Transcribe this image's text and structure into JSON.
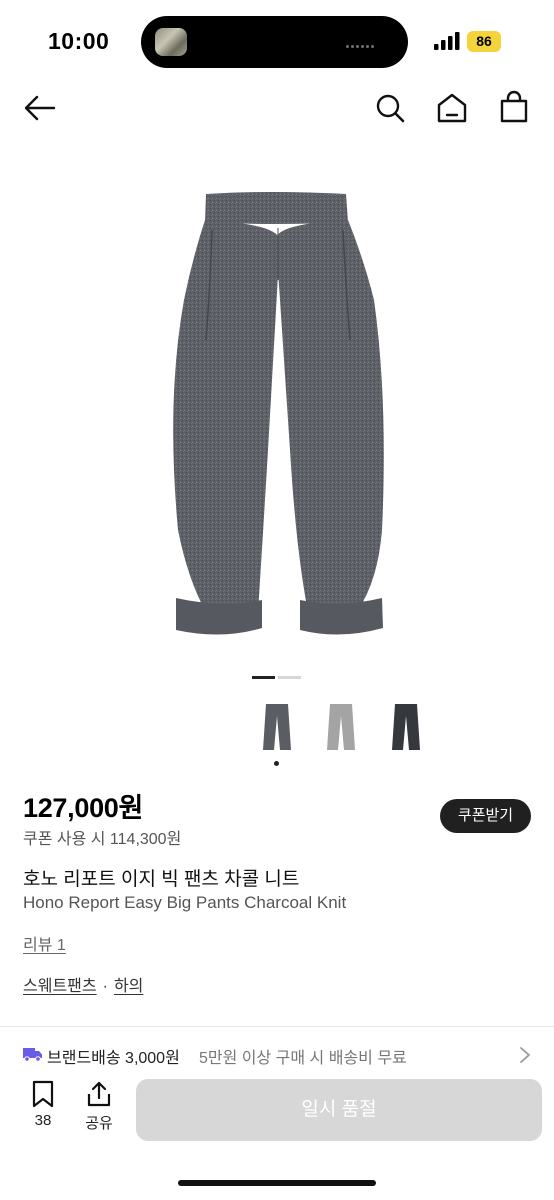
{
  "status_bar": {
    "time": "10:00",
    "battery": "86",
    "battery_color": "#f5d43b"
  },
  "header": {
    "icons": [
      "arrow-left-icon",
      "search-icon",
      "home-icon",
      "shopping-bag-icon"
    ]
  },
  "product": {
    "image_icon": "charcoal-pants-image",
    "image_count": 2,
    "current_image": 1,
    "color_options": [
      {
        "name": "charcoal-thumb",
        "color": "#5a5d63",
        "selected": true
      },
      {
        "name": "grey-thumb",
        "color": "#a4a4a4",
        "selected": false
      },
      {
        "name": "black-thumb",
        "color": "#35383d",
        "selected": false
      }
    ],
    "price": "127,000원",
    "coupon_price": "쿠폰 사용 시 114,300원",
    "coupon_button": "쿠폰받기",
    "title_ko": "호노 리포트 이지 빅 팬츠 차콜 니트",
    "title_en": "Hono Report Easy Big Pants Charcoal Knit",
    "review_link": "리뷰 1",
    "categories": [
      "스웨트팬츠",
      "하의"
    ],
    "category_separator": "·"
  },
  "shipping": {
    "label": "브랜드배송 3,000원",
    "note": "5만원 이상 구매 시 배송비 무료",
    "accent_color": "#6b5ce7"
  },
  "bottom_bar": {
    "wishlist_count": "38",
    "share_label": "공유",
    "soldout_label": "일시 품절"
  }
}
